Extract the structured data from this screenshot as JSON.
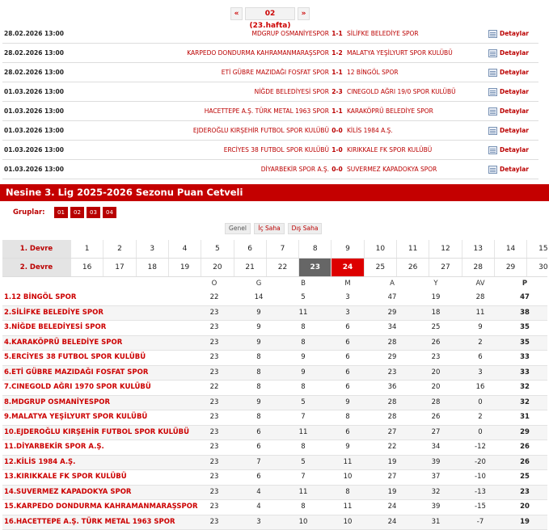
{
  "week_nav": {
    "prev": "«",
    "current": "02 (23.hafta)",
    "next": "»"
  },
  "fixtures": [
    {
      "date": "28.02.2026 13:00",
      "home": "MDGRUP OSMANİYESPOR",
      "score": "1-1",
      "away": "SİLİFKE BELEDİYE SPOR",
      "details": "Detaylar"
    },
    {
      "date": "28.02.2026 13:00",
      "home": "KARPEDO DONDURMA KAHRAMANMARAŞSPOR",
      "score": "1-2",
      "away": "MALATYA YEŞİLYURT SPOR KULÜBÜ",
      "details": "Detaylar"
    },
    {
      "date": "28.02.2026 13:00",
      "home": "ETİ GÜBRE MAZIDAĞI FOSFAT SPOR",
      "score": "1-1",
      "away": "12 BİNGÖL SPOR",
      "details": "Detaylar"
    },
    {
      "date": "01.03.2026 13:00",
      "home": "NİĞDE BELEDİYESİ SPOR",
      "score": "2-3",
      "away": "CINEGOLD AĞRI 19/0 SPOR KULÜBÜ",
      "details": "Detaylar"
    },
    {
      "date": "01.03.2026 13:00",
      "home": "HACETTEPE A.Ş. TÜRK METAL 1963 SPOR",
      "score": "1-1",
      "away": "KARAKÖPRÜ BELEDİYE SPOR",
      "details": "Detaylar"
    },
    {
      "date": "01.03.2026 13:00",
      "home": "EJDEROĞLU KIRŞEHİR FUTBOL SPOR KULÜBÜ",
      "score": "0-0",
      "away": "KİLİS 1984 A.Ş.",
      "details": "Detaylar"
    },
    {
      "date": "01.03.2026 13:00",
      "home": "ERCİYES 38 FUTBOL SPOR KULÜBÜ",
      "score": "1-0",
      "away": "KIRIKKALE FK SPOR KULÜBÜ",
      "details": "Detaylar"
    },
    {
      "date": "01.03.2026 13:00",
      "home": "DİYARBEKİR SPOR A.Ş.",
      "score": "0-0",
      "away": "SUVERMEZ KAPADOKYA SPOR",
      "details": "Detaylar"
    }
  ],
  "standings_title": "Nesine 3. Lig 2025-2026 Sezonu Puan Cetveli",
  "groups": {
    "label": "Gruplar:",
    "items": [
      "01",
      "02",
      "03",
      "04"
    ]
  },
  "tabs": {
    "genel": "Genel",
    "ic_saha": "İç Saha",
    "dis_saha": "Dış Saha"
  },
  "week_grid": {
    "first_label": "1. Devre",
    "second_label": "2. Devre",
    "first": [
      "1",
      "2",
      "3",
      "4",
      "5",
      "6",
      "7",
      "8",
      "9",
      "10",
      "11",
      "12",
      "13",
      "14",
      "15"
    ],
    "second": [
      "16",
      "17",
      "18",
      "19",
      "20",
      "21",
      "22",
      "23",
      "24",
      "25",
      "26",
      "27",
      "28",
      "29",
      "30"
    ],
    "played_week": "23",
    "current_week": "24"
  },
  "columns": {
    "o": "O",
    "g": "G",
    "b": "B",
    "m": "M",
    "a": "A",
    "y": "Y",
    "av": "AV",
    "p": "P"
  },
  "standings": [
    {
      "team": "1.12 BİNGÖL SPOR",
      "o": "22",
      "g": "14",
      "b": "5",
      "m": "3",
      "a": "47",
      "y": "19",
      "av": "28",
      "p": "47"
    },
    {
      "team": "2.SİLİFKE BELEDİYE SPOR",
      "o": "23",
      "g": "9",
      "b": "11",
      "m": "3",
      "a": "29",
      "y": "18",
      "av": "11",
      "p": "38"
    },
    {
      "team": "3.NİĞDE BELEDİYESİ SPOR",
      "o": "23",
      "g": "9",
      "b": "8",
      "m": "6",
      "a": "34",
      "y": "25",
      "av": "9",
      "p": "35"
    },
    {
      "team": "4.KARAKÖPRÜ BELEDİYE SPOR",
      "o": "23",
      "g": "9",
      "b": "8",
      "m": "6",
      "a": "28",
      "y": "26",
      "av": "2",
      "p": "35"
    },
    {
      "team": "5.ERCİYES 38 FUTBOL SPOR KULÜBÜ",
      "o": "23",
      "g": "8",
      "b": "9",
      "m": "6",
      "a": "29",
      "y": "23",
      "av": "6",
      "p": "33"
    },
    {
      "team": "6.ETİ GÜBRE MAZIDAĞI FOSFAT SPOR",
      "o": "23",
      "g": "8",
      "b": "9",
      "m": "6",
      "a": "23",
      "y": "20",
      "av": "3",
      "p": "33"
    },
    {
      "team": "7.CINEGOLD AĞRI 1970 SPOR KULÜBÜ",
      "o": "22",
      "g": "8",
      "b": "8",
      "m": "6",
      "a": "36",
      "y": "20",
      "av": "16",
      "p": "32"
    },
    {
      "team": "8.MDGRUP OSMANİYESPOR",
      "o": "23",
      "g": "9",
      "b": "5",
      "m": "9",
      "a": "28",
      "y": "28",
      "av": "0",
      "p": "32"
    },
    {
      "team": "9.MALATYA YEŞİLYURT SPOR KULÜBÜ",
      "o": "23",
      "g": "8",
      "b": "7",
      "m": "8",
      "a": "28",
      "y": "26",
      "av": "2",
      "p": "31"
    },
    {
      "team": "10.EJDEROĞLU KIRŞEHİR FUTBOL SPOR KULÜBÜ",
      "o": "23",
      "g": "6",
      "b": "11",
      "m": "6",
      "a": "27",
      "y": "27",
      "av": "0",
      "p": "29"
    },
    {
      "team": "11.DİYARBEKİR SPOR A.Ş.",
      "o": "23",
      "g": "6",
      "b": "8",
      "m": "9",
      "a": "22",
      "y": "34",
      "av": "-12",
      "p": "26"
    },
    {
      "team": "12.KİLİS 1984 A.Ş.",
      "o": "23",
      "g": "7",
      "b": "5",
      "m": "11",
      "a": "19",
      "y": "39",
      "av": "-20",
      "p": "26"
    },
    {
      "team": "13.KIRIKKALE FK SPOR KULÜBÜ",
      "o": "23",
      "g": "6",
      "b": "7",
      "m": "10",
      "a": "27",
      "y": "37",
      "av": "-10",
      "p": "25"
    },
    {
      "team": "14.SUVERMEZ KAPADOKYA SPOR",
      "o": "23",
      "g": "4",
      "b": "11",
      "m": "8",
      "a": "19",
      "y": "32",
      "av": "-13",
      "p": "23"
    },
    {
      "team": "15.KARPEDO DONDURMA KAHRAMANMARAŞSPOR",
      "o": "23",
      "g": "4",
      "b": "8",
      "m": "11",
      "a": "24",
      "y": "39",
      "av": "-15",
      "p": "20"
    },
    {
      "team": "16.HACETTEPE A.Ş. TÜRK METAL 1963 SPOR",
      "o": "23",
      "g": "3",
      "b": "10",
      "m": "10",
      "a": "24",
      "y": "31",
      "av": "-7",
      "p": "19"
    }
  ]
}
